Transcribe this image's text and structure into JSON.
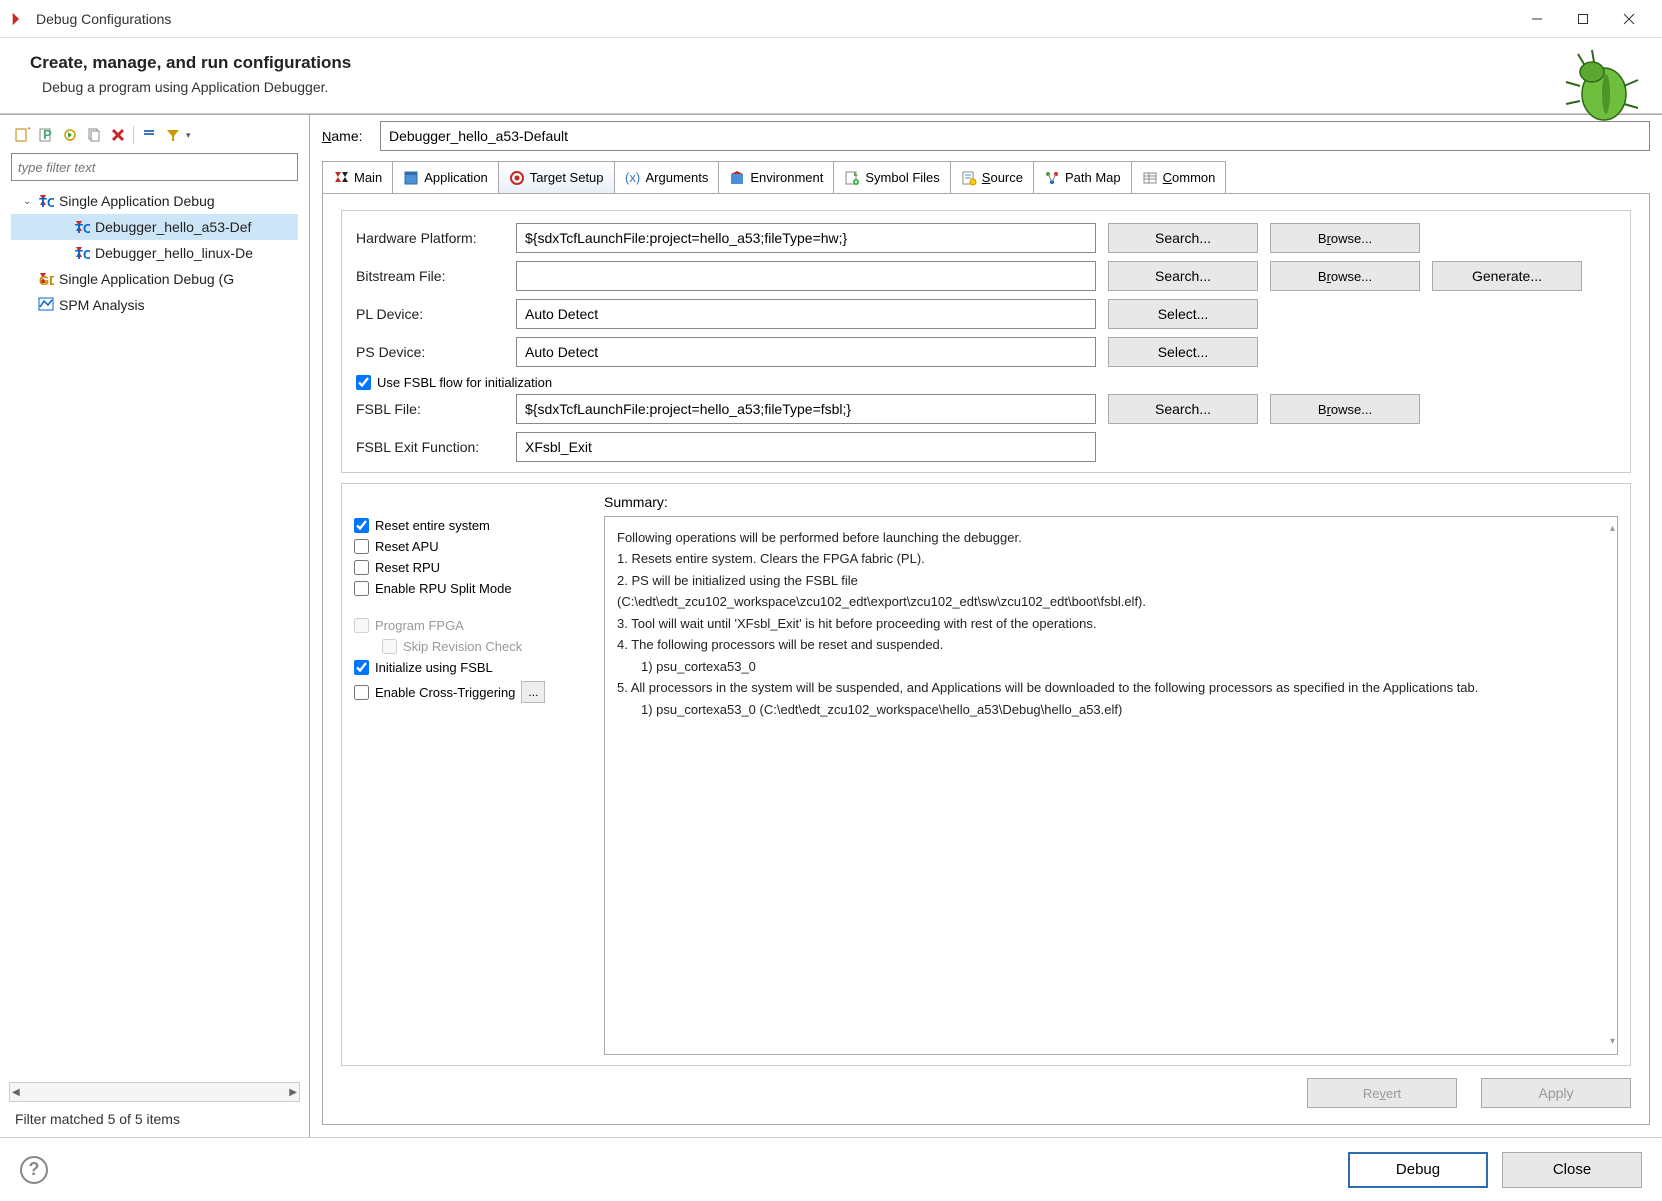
{
  "window": {
    "title": "Debug Configurations"
  },
  "header": {
    "title": "Create, manage, and run configurations",
    "subtitle": "Debug a program using Application Debugger."
  },
  "filter": {
    "placeholder": "type filter text"
  },
  "tree": {
    "items": [
      {
        "label": "Single Application Debug",
        "level": 1,
        "expanded": true,
        "icon": "tcf"
      },
      {
        "label": "Debugger_hello_a53-Def",
        "level": 2,
        "selected": true,
        "icon": "tcf"
      },
      {
        "label": "Debugger_hello_linux-De",
        "level": 2,
        "icon": "tcf"
      },
      {
        "label": "Single Application Debug (G",
        "level": 1,
        "icon": "gdb"
      },
      {
        "label": "SPM Analysis",
        "level": 1,
        "icon": "spm"
      }
    ]
  },
  "left_status": "Filter matched 5 of 5 items",
  "name": {
    "label": "Name:",
    "value": "Debugger_hello_a53-Default"
  },
  "tabs": [
    {
      "label": "Main",
      "icon": "main"
    },
    {
      "label": "Application",
      "icon": "app"
    },
    {
      "label": "Target Setup",
      "icon": "target",
      "active": true
    },
    {
      "label": "Arguments",
      "icon": "args"
    },
    {
      "label": "Environment",
      "icon": "env"
    },
    {
      "label": "Symbol Files",
      "icon": "sym"
    },
    {
      "label": "Source",
      "icon": "src"
    },
    {
      "label": "Path Map",
      "icon": "path"
    },
    {
      "label": "Common",
      "icon": "common"
    }
  ],
  "form": {
    "hw_platform": {
      "label": "Hardware Platform:",
      "value": "${sdxTcfLaunchFile:project=hello_a53;fileType=hw;}"
    },
    "bitstream": {
      "label": "Bitstream File:",
      "value": ""
    },
    "pl_device": {
      "label": "PL Device:",
      "value": "Auto Detect"
    },
    "ps_device": {
      "label": "PS Device:",
      "value": "Auto Detect"
    },
    "use_fsbl": {
      "label": "Use FSBL flow for initialization"
    },
    "fsbl_file": {
      "label": "FSBL File:",
      "value": "${sdxTcfLaunchFile:project=hello_a53;fileType=fsbl;}"
    },
    "fsbl_exit": {
      "label": "FSBL Exit Function:",
      "value": "XFsbl_Exit"
    },
    "btn_search": "Search...",
    "btn_browse": "Browse...",
    "btn_generate": "Generate...",
    "btn_select": "Select..."
  },
  "checks": {
    "reset_system": "Reset entire system",
    "reset_apu": "Reset APU",
    "reset_rpu": "Reset RPU",
    "enable_rpu_split": "Enable RPU Split Mode",
    "program_fpga": "Program FPGA",
    "skip_revision": "Skip Revision Check",
    "init_fsbl": "Initialize using FSBL",
    "cross_trigger": "Enable Cross-Triggering"
  },
  "summary": {
    "label": "Summary:",
    "lines": [
      "Following operations will be performed before launching the debugger.",
      "1. Resets entire system. Clears the FPGA fabric (PL).",
      "2. PS will be initialized using the FSBL file",
      "(C:\\edt\\edt_zcu102_workspace\\zcu102_edt\\export\\zcu102_edt\\sw\\zcu102_edt\\boot\\fsbl.elf).",
      "3. Tool will wait until 'XFsbl_Exit' is hit before proceeding with rest of the operations.",
      "4. The following processors will be reset and suspended.",
      "    1) psu_cortexa53_0",
      "5. All processors in the system will be suspended, and Applications will be downloaded to the following processors as specified in the Applications tab.",
      "    1) psu_cortexa53_0 (C:\\edt\\edt_zcu102_workspace\\hello_a53\\Debug\\hello_a53.elf)"
    ]
  },
  "bottom": {
    "revert": "Revert",
    "apply": "Apply"
  },
  "footer": {
    "debug": "Debug",
    "close": "Close"
  }
}
